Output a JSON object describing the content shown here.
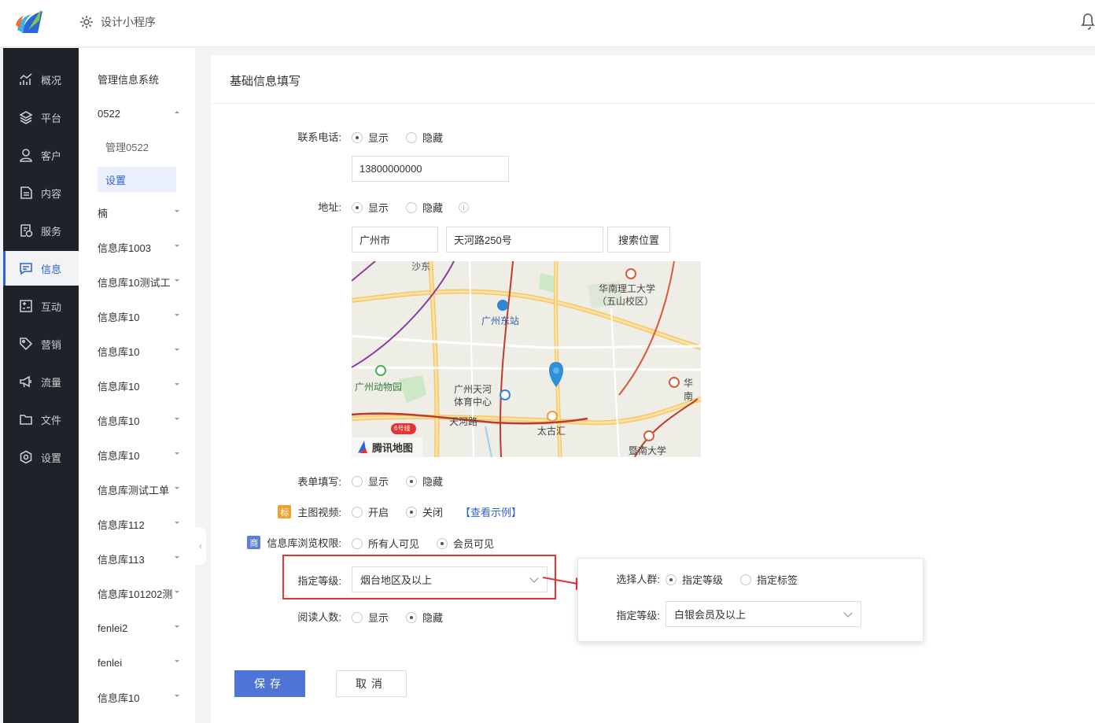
{
  "header": {
    "app_title": "设计小程序"
  },
  "nav": {
    "items": [
      {
        "label": "概况",
        "icon": "chart-trend-icon"
      },
      {
        "label": "平台",
        "icon": "layers-icon"
      },
      {
        "label": "客户",
        "icon": "user-icon"
      },
      {
        "label": "内容",
        "icon": "document-icon"
      },
      {
        "label": "服务",
        "icon": "service-doc-icon"
      },
      {
        "label": "信息",
        "icon": "message-icon",
        "active": true
      },
      {
        "label": "互动",
        "icon": "interaction-icon"
      },
      {
        "label": "营销",
        "icon": "tag-icon"
      },
      {
        "label": "流量",
        "icon": "megaphone-icon"
      },
      {
        "label": "文件",
        "icon": "folder-icon"
      },
      {
        "label": "设置",
        "icon": "settings-icon"
      }
    ]
  },
  "subnav": {
    "title": "管理信息系统",
    "group_0522": "0522",
    "child_manage": "管理0522",
    "child_settings": "设置",
    "items": [
      "楠",
      "信息库1003",
      "信息库10测试工",
      "信息库10",
      "信息库10",
      "信息库10",
      "信息库10",
      "信息库10",
      "信息库测试工单",
      "信息库112",
      "信息库113",
      "信息库101202测",
      "fenlei2",
      "fenlei",
      "信息库10"
    ]
  },
  "panel": {
    "title": "基础信息填写",
    "phone": {
      "label": "联系电话:",
      "show": "显示",
      "hide": "隐藏",
      "value": "13800000000"
    },
    "address": {
      "label": "地址:",
      "show": "显示",
      "hide": "隐藏",
      "info": "i",
      "city": "广州市",
      "street": "天河路250号",
      "search_btn": "搜索位置"
    },
    "map": {
      "labels": [
        "沙东",
        "华南理工大学",
        "（五山校区）",
        "广州东站",
        "广州动物园",
        "广州天河",
        "体育中心",
        "天河路",
        "太古汇",
        "华南",
        "暨南大学",
        "6号线"
      ],
      "brand": "腾讯地图"
    },
    "form_fill": {
      "label": "表单填写:",
      "show": "显示",
      "hide": "隐藏"
    },
    "main_video": {
      "badge": "标",
      "label": "主图视频:",
      "on": "开启",
      "off": "关闭",
      "example": "【查看示例】"
    },
    "browse_perm": {
      "badge": "商",
      "label": "信息库浏览权限:",
      "all": "所有人可见",
      "member": "会员可见"
    },
    "level": {
      "label": "指定等级:",
      "value": "烟台地区及以上"
    },
    "read_count": {
      "label": "阅读人数:",
      "show": "显示",
      "hide": "隐藏"
    },
    "popup": {
      "crowd_label": "选择人群:",
      "opt_level": "指定等级",
      "opt_tag": "指定标签",
      "level_label": "指定等级:",
      "level_value": "白银会员及以上"
    },
    "save": "保存",
    "cancel": "取消"
  },
  "colors": {
    "accent": "#2f63d8",
    "primary_btn": "#4e74d6",
    "nav_bg": "#1f2329",
    "highlight_red": "#e63232",
    "badge_orange": "#f0a030",
    "badge_blue": "#5b7fe0"
  }
}
